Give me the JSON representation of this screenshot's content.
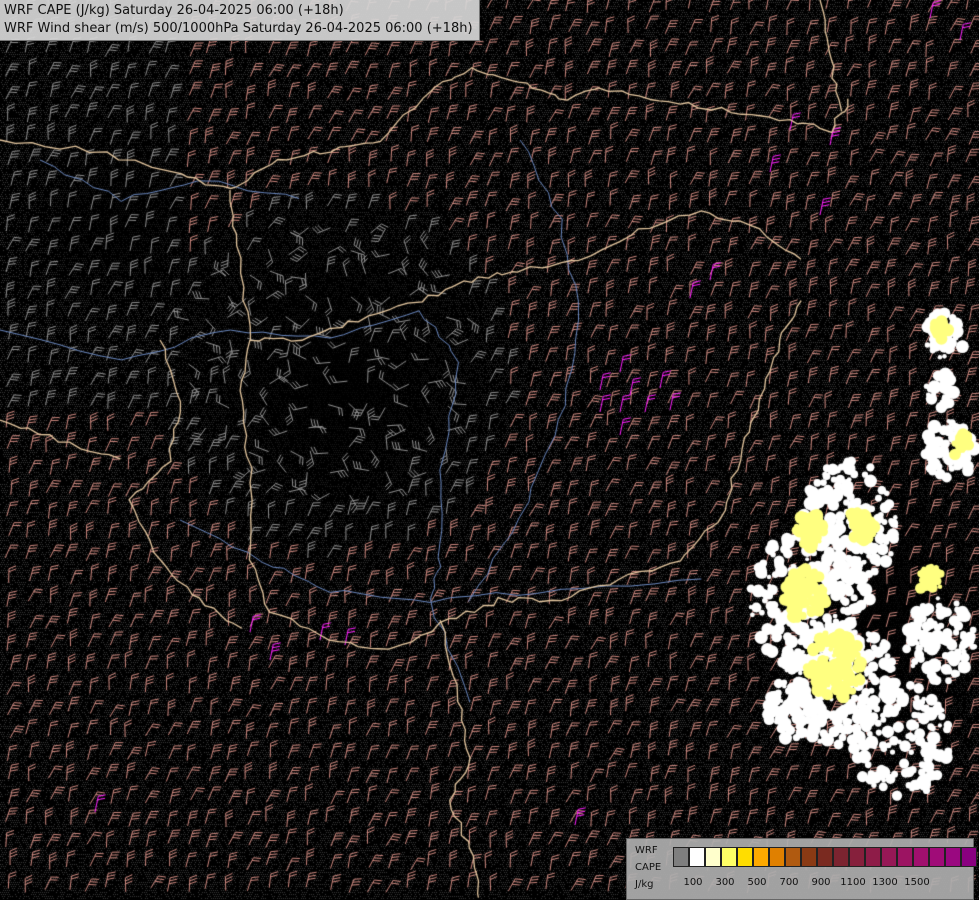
{
  "header": {
    "line1": "WRF CAPE (J/kg) Saturday 26-04-2025 06:00 (+18h)",
    "line2": "WRF Wind shear (m/s) 500/1000hPa Saturday 26-04-2025 06:00 (+18h)"
  },
  "legend": {
    "model": "WRF",
    "parameter": "CAPE",
    "unit": "J/kg",
    "colors": [
      "#7f7f7f",
      "#ffffff",
      "#ffffcc",
      "#ffff66",
      "#ffdd00",
      "#ffaa00",
      "#e08000",
      "#b05a10",
      "#8a3a14",
      "#7a2a20",
      "#7c2430",
      "#86203c",
      "#8e1c48",
      "#961856",
      "#9c1462",
      "#a0106e",
      "#a00c78",
      "#9a0880",
      "#8a0080"
    ],
    "ticks": [
      "100",
      "300",
      "500",
      "700",
      "900",
      "1100",
      "1300",
      "1500"
    ]
  },
  "map_style": {
    "background": "#000000",
    "stipple": "#3a3a3a",
    "border_color": "#e6c8a0",
    "river_color": "#6a88c0",
    "barb_low": "#909090",
    "barb_high": "#d08a80",
    "barb_strong": "#ff20ff",
    "cape_low": "#ffffff",
    "cape_mid": "#ffff80"
  }
}
